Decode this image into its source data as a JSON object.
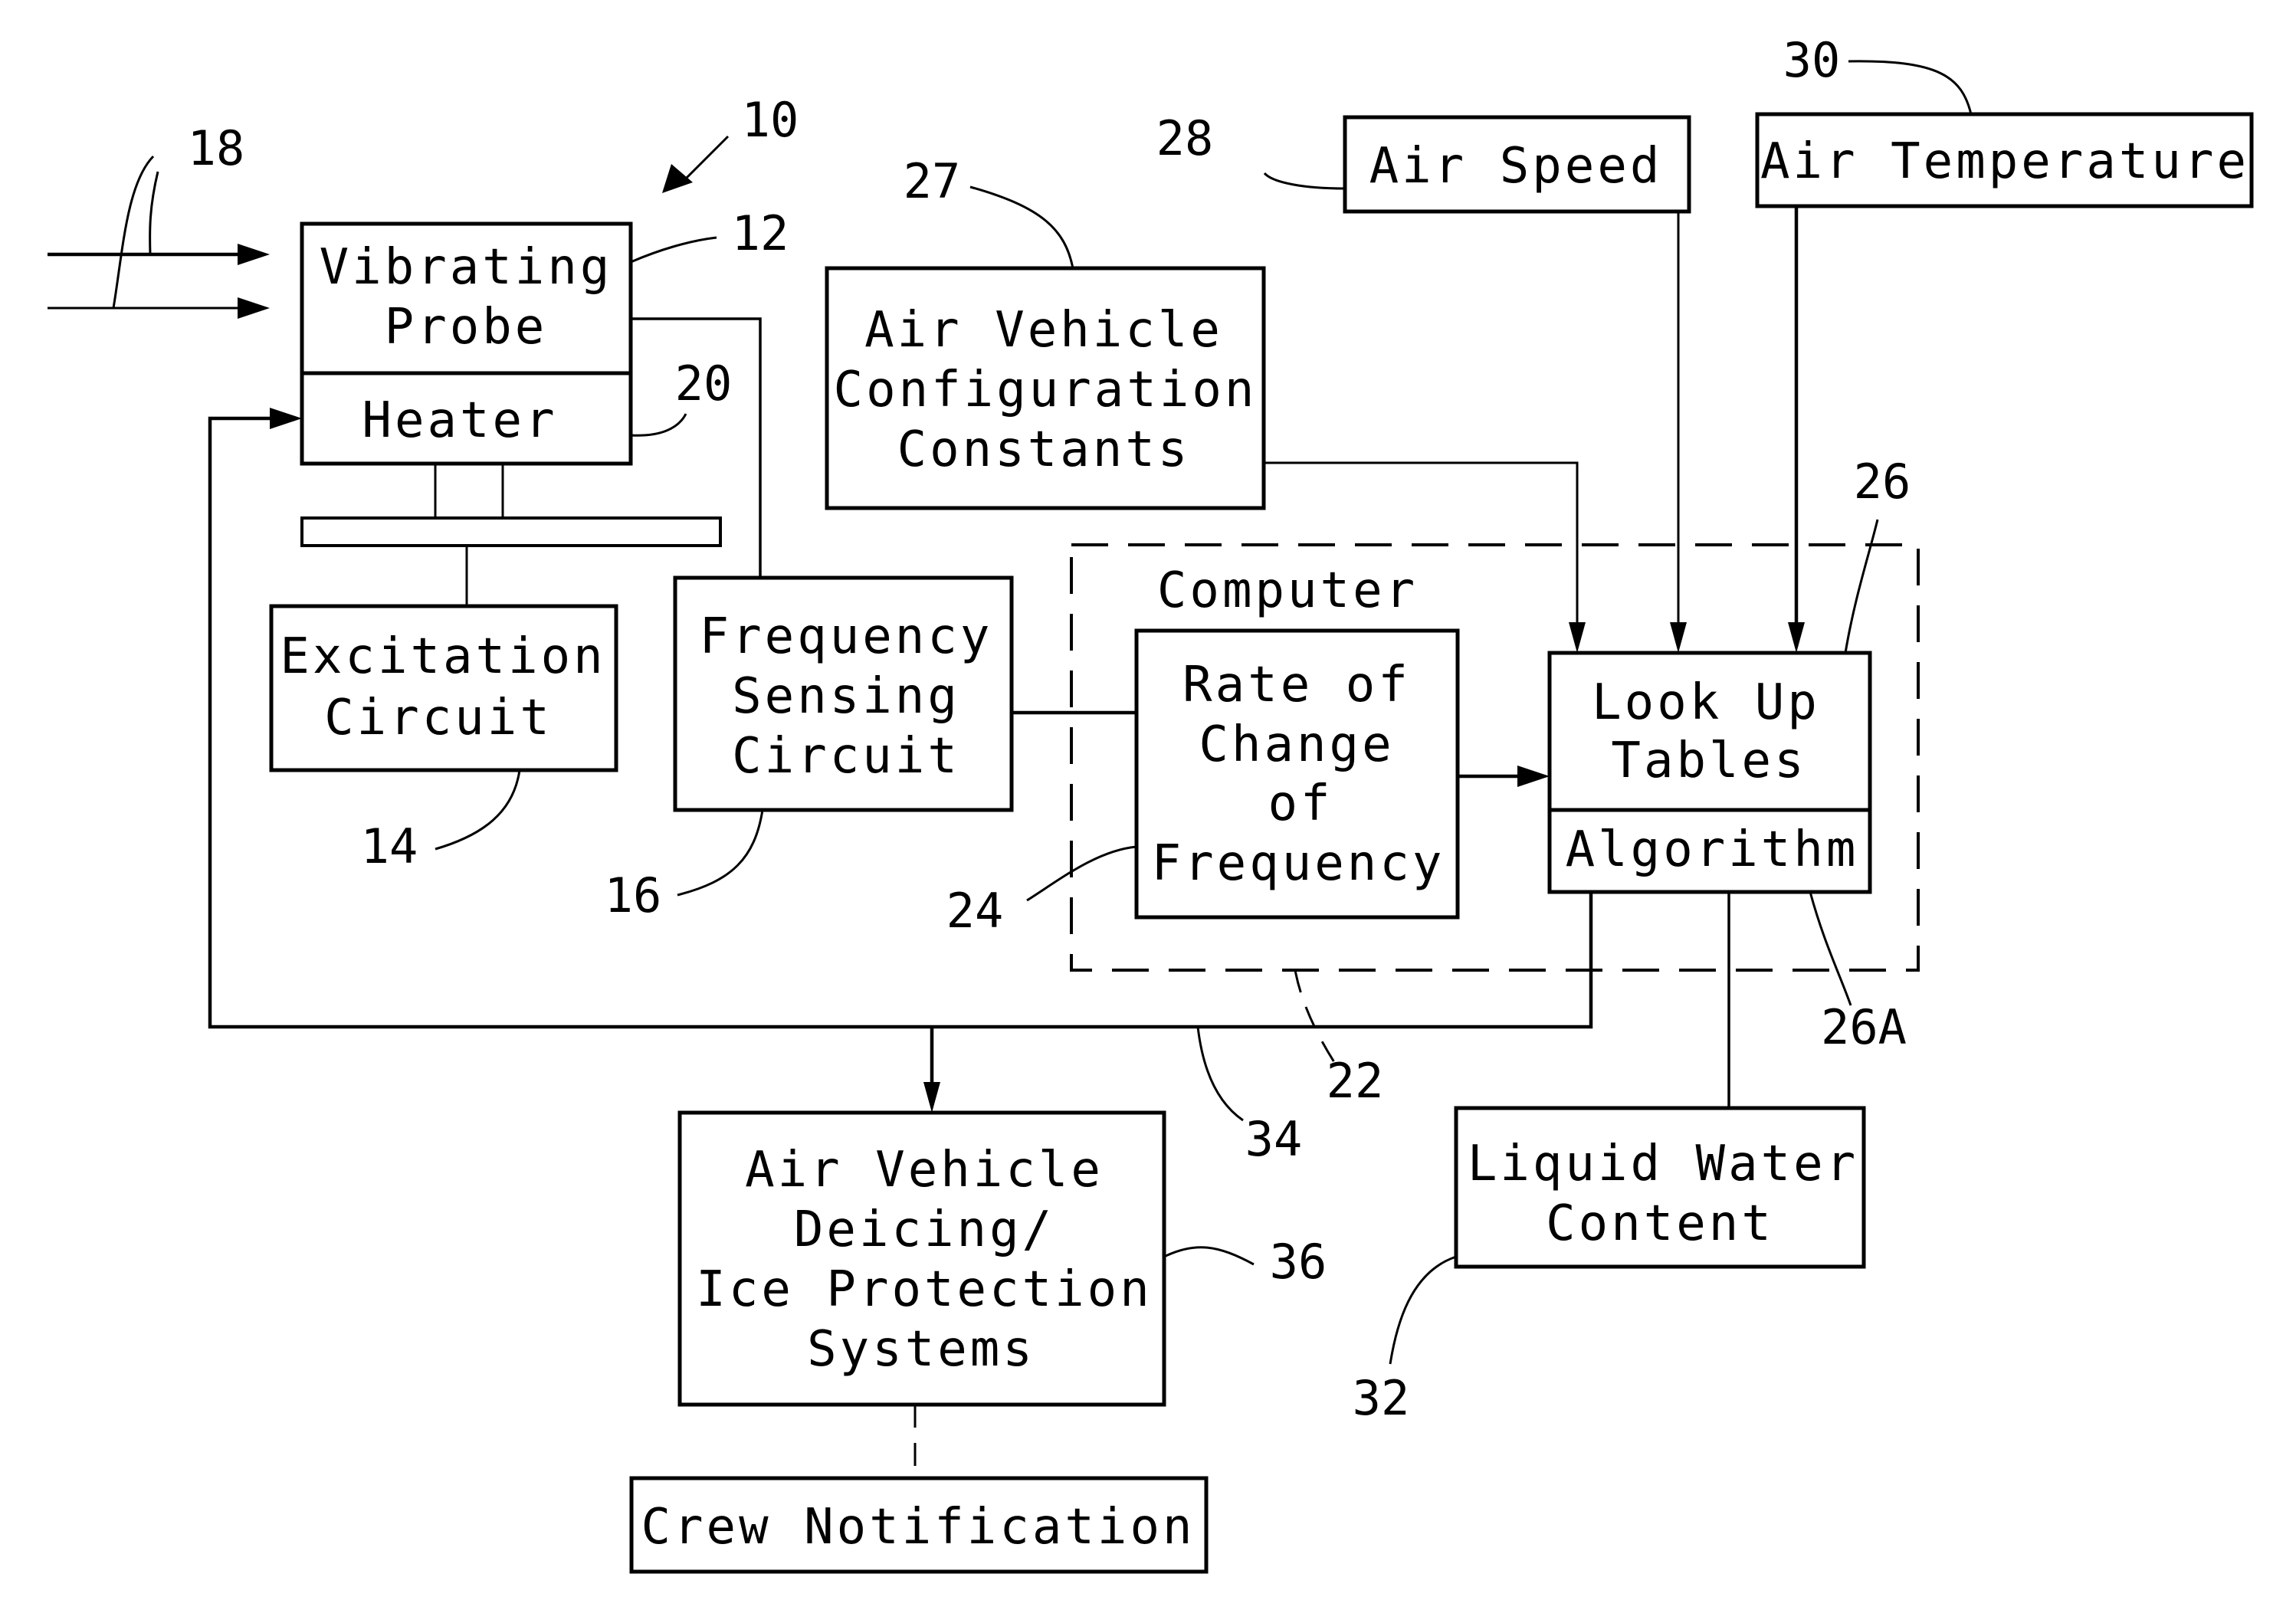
{
  "diagram": {
    "type": "block-diagram",
    "blocks": {
      "vibrating_probe": {
        "lines": [
          "Vibrating",
          "Probe"
        ],
        "ref": "12"
      },
      "heater": {
        "lines": [
          "Heater"
        ],
        "ref": "20"
      },
      "excitation_circuit": {
        "lines": [
          "Excitation",
          "Circuit"
        ],
        "ref": "14"
      },
      "frequency_sensing": {
        "lines": [
          "Frequency",
          "Sensing",
          "Circuit"
        ],
        "ref": "16"
      },
      "computer": {
        "label": "Computer",
        "ref": "22"
      },
      "rate_of_change": {
        "lines": [
          "Rate of",
          "Change",
          "of",
          "Frequency"
        ],
        "ref": "24"
      },
      "look_up_tables": {
        "lines": [
          "Look Up",
          "Tables"
        ],
        "ref": "26"
      },
      "algorithm": {
        "lines": [
          "Algorithm"
        ],
        "ref": "26A"
      },
      "vehicle_config": {
        "lines": [
          "Air Vehicle",
          "Configuration",
          "Constants"
        ],
        "ref": "27"
      },
      "air_speed": {
        "lines": [
          "Air Speed"
        ],
        "ref": "28"
      },
      "air_temperature": {
        "lines": [
          "Air Temperature"
        ],
        "ref": "30"
      },
      "liquid_water": {
        "lines": [
          "Liquid Water",
          "Content"
        ],
        "ref": "32"
      },
      "deicing": {
        "lines": [
          "Air Vehicle",
          "Deicing/",
          "Ice Protection",
          "Systems"
        ],
        "ref": "36"
      },
      "crew_notification": {
        "lines": [
          "Crew Notification"
        ]
      }
    },
    "refs": {
      "system": "10",
      "airflow": "18",
      "feedback_line": "34"
    }
  }
}
